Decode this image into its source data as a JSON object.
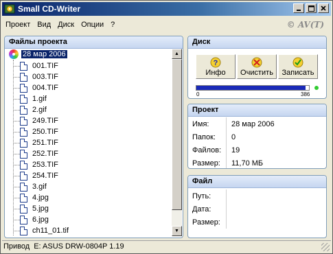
{
  "window": {
    "title": "Small CD-Writer",
    "brand": "© AV(T)"
  },
  "menu": [
    "Проект",
    "Вид",
    "Диск",
    "Опции",
    "?"
  ],
  "files_panel": {
    "header": "Файлы проекта",
    "root": "28 мар 2006",
    "files": [
      "001.TIF",
      "003.TIF",
      "004.TIF",
      "1.gif",
      "2.gif",
      "249.TIF",
      "250.TIF",
      "251.TIF",
      "252.TIF",
      "253.TIF",
      "254.TIF",
      "3.gif",
      "4.jpg",
      "5.jpg",
      "6.jpg",
      "ch11_01.tif"
    ]
  },
  "disc_panel": {
    "header": "Диск",
    "buttons": [
      {
        "label": "Инфо",
        "icon": "info-icon"
      },
      {
        "label": "Очистить",
        "icon": "erase-icon"
      },
      {
        "label": "Записать",
        "icon": "burn-icon"
      }
    ],
    "progress": {
      "min": "0",
      "max": "386",
      "fill_fraction": 0.97
    }
  },
  "project_panel": {
    "header": "Проект",
    "rows": [
      {
        "label": "Имя:",
        "value": "28 мар 2006"
      },
      {
        "label": "Папок:",
        "value": "0"
      },
      {
        "label": "Файлов:",
        "value": "19"
      },
      {
        "label": "Размер:",
        "value": "11,70 МБ"
      }
    ]
  },
  "file_panel": {
    "header": "Файл",
    "rows": [
      {
        "label": "Путь:",
        "value": ""
      },
      {
        "label": "Дата:",
        "value": ""
      },
      {
        "label": "Размер:",
        "value": ""
      }
    ]
  },
  "status": {
    "label": "Привод",
    "value": "E: ASUS DRW-0804P 1.19"
  },
  "colors": {
    "titlebar": "#0a246a",
    "selection": "#0a246a",
    "progress": "#1a2ab8",
    "panel_border": "#7f9db9"
  }
}
